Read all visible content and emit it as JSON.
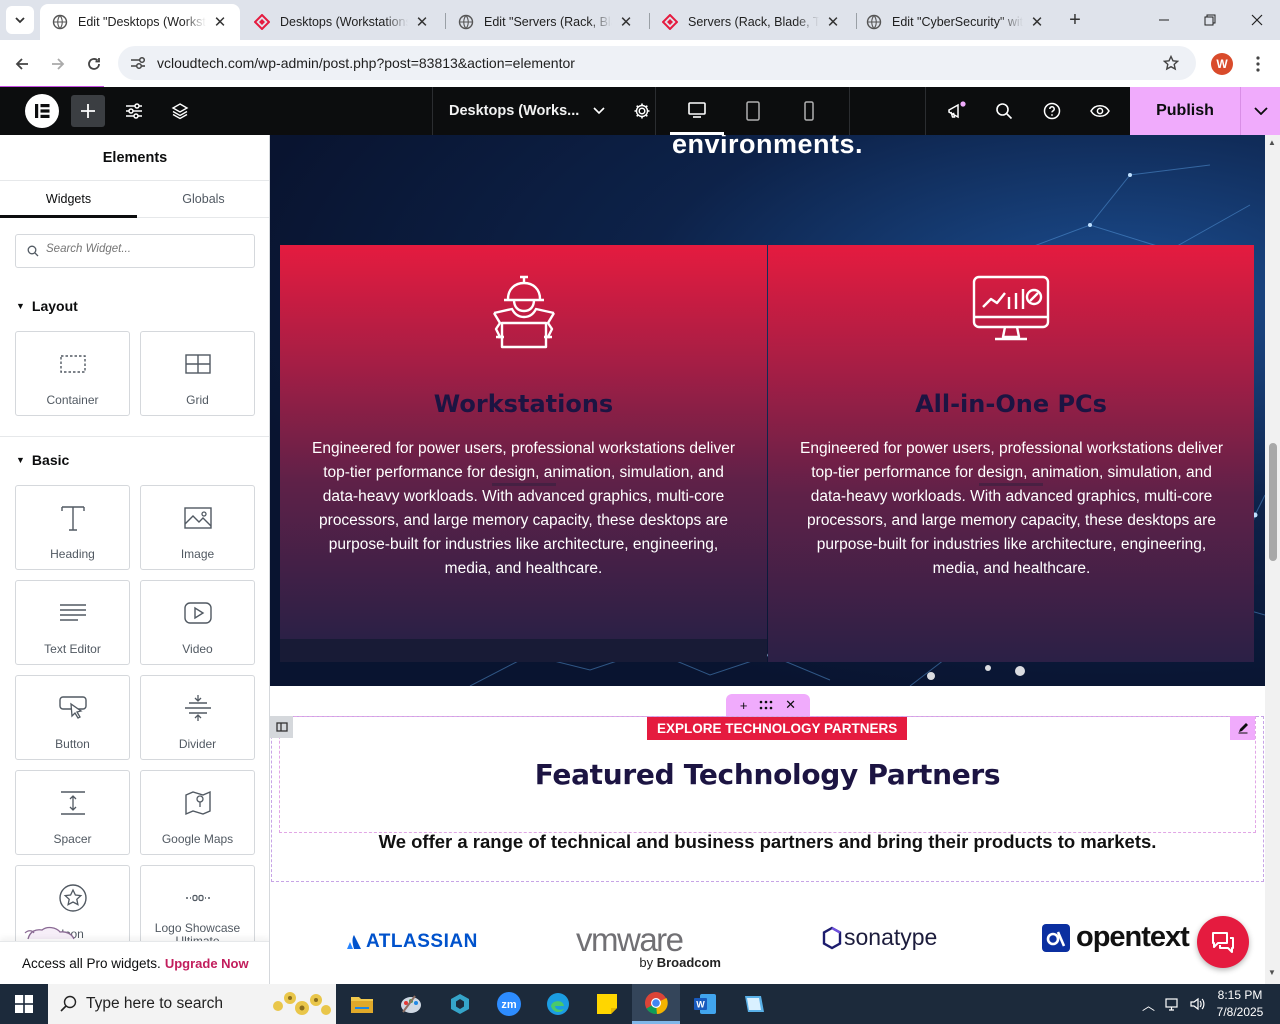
{
  "browser": {
    "tabs": [
      {
        "title": "Edit \"Desktops (Workstations",
        "active": true
      },
      {
        "title": "Desktops (Workstations, All-in-One PCs",
        "active": false
      },
      {
        "title": "Edit \"Servers (Rack, Blade",
        "active": false
      },
      {
        "title": "Servers (Rack, Blade, Tower",
        "active": false
      },
      {
        "title": "Edit \"CyberSecurity\" with Elementor",
        "active": false
      }
    ],
    "url": "vcloudtech.com/wp-admin/post.php?post=83813&action=elementor",
    "profile_initial": "W"
  },
  "editor": {
    "page_title": "Desktops (Works...",
    "publish_label": "Publish"
  },
  "panel": {
    "title": "Elements",
    "tabs": [
      "Widgets",
      "Globals"
    ],
    "search_placeholder": "Search Widget...",
    "layout_heading": "Layout",
    "basic_heading": "Basic",
    "layout_widgets": [
      {
        "label": "Container",
        "icon": "container-icon"
      },
      {
        "label": "Grid",
        "icon": "grid-icon"
      }
    ],
    "basic_widgets": [
      {
        "label": "Heading",
        "icon": "heading-icon"
      },
      {
        "label": "Image",
        "icon": "image-icon"
      },
      {
        "label": "Text Editor",
        "icon": "text-editor-icon"
      },
      {
        "label": "Video",
        "icon": "video-icon"
      },
      {
        "label": "Button",
        "icon": "button-icon"
      },
      {
        "label": "Divider",
        "icon": "divider-icon"
      },
      {
        "label": "Spacer",
        "icon": "spacer-icon"
      },
      {
        "label": "Google Maps",
        "icon": "google-maps-icon"
      },
      {
        "label": "Icon",
        "icon": "star-icon"
      },
      {
        "label": "Logo Showcase Ultimate",
        "icon": "logo-showcase-icon"
      }
    ],
    "upgrade_text": "Access all Pro widgets.",
    "upgrade_link": "Upgrade Now"
  },
  "preview": {
    "hero_heading": "environments.",
    "cards": [
      {
        "title": "Workstations",
        "icon": "engineer-workstation-icon",
        "body": "Engineered for power users, professional workstations deliver top-tier performance for design, animation, simulation, and data-heavy workloads. With advanced graphics, multi-core processors, and large memory capacity, these desktops are purpose-built for industries like architecture, engineering, media, and healthcare."
      },
      {
        "title": "All-in-One PCs",
        "icon": "monitor-analytics-icon",
        "body": "Engineered for power users, professional workstations deliver top-tier performance for design, animation, simulation, and data-heavy workloads. With advanced graphics, multi-core processors, and large memory capacity, these desktops are purpose-built for industries like architecture, engineering, media, and healthcare."
      }
    ],
    "badge": "EXPLORE TECHNOLOGY PARTNERS",
    "featured_heading": "Featured Technology Partners",
    "featured_sub": "We offer a range of technical and business partners and bring their products to markets.",
    "logos": {
      "atlassian": "ATLASSIAN",
      "vmware": "vmware",
      "vmware_by": "by",
      "broadcom": "Broadcom",
      "sonatype": "sonatype",
      "opentext": "opentext"
    }
  },
  "taskbar": {
    "search_placeholder": "Type here to search",
    "time": "8:15 PM",
    "date": "7/8/2025"
  },
  "colors": {
    "accent_pink": "#f0abfc",
    "brand_red": "#e51b3f",
    "dark_navy": "#1c1442"
  }
}
